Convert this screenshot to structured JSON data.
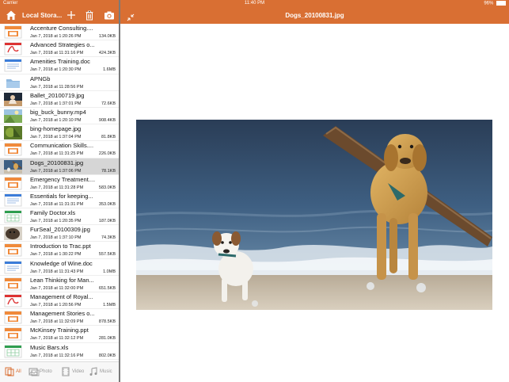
{
  "status_bar": {
    "carrier": "Carrier",
    "time": "11:40 PM",
    "battery": "96%",
    "battery_level": 0.96
  },
  "nav": {
    "home_icon": "home-icon",
    "title": "Local Stora...",
    "add_icon": "plus-icon",
    "trash_icon": "trash-icon",
    "camera_icon": "camera-icon",
    "collapse_icon": "collapse-arrows-icon",
    "viewer_title": "Dogs_20100831.jpg"
  },
  "colors": {
    "accent": "#D96F33",
    "selected_row": "#d6d6d6",
    "tab_inactive": "#999999"
  },
  "files": [
    {
      "name": "Accenture Consulting....",
      "date": "Jan 7, 2018 at 1:20:26 PM",
      "size": "134.0KB",
      "icon": "ppt"
    },
    {
      "name": "Advanced Strategies o...",
      "date": "Jan 7, 2018 at 11:31:16 PM",
      "size": "424.3KB",
      "icon": "pdf"
    },
    {
      "name": "Amenities Training.doc",
      "date": "Jan 7, 2018 at 1:20:30 PM",
      "size": "1.6MB",
      "icon": "doc"
    },
    {
      "name": "APNGb",
      "date": "Jan 7, 2018 at 11:28:56 PM",
      "size": "",
      "icon": "folder"
    },
    {
      "name": "Ballet_20100719.jpg",
      "date": "Jan 7, 2018 at 1:37:01 PM",
      "size": "72.6KB",
      "icon": "photo-ballet"
    },
    {
      "name": "big_buck_bunny.mp4",
      "date": "Jan 7, 2018 at 1:20:10 PM",
      "size": "908.4KB",
      "icon": "video"
    },
    {
      "name": "bing-homepage.jpg",
      "date": "Jan 7, 2018 at 1:37:04 PM",
      "size": "81.8KB",
      "icon": "photo-green"
    },
    {
      "name": "Communication Skills....",
      "date": "Jan 7, 2018 at 11:31:25 PM",
      "size": "226.0KB",
      "icon": "ppt"
    },
    {
      "name": "Dogs_20100831.jpg",
      "date": "Jan 7, 2018 at 1:37:06 PM",
      "size": "78.1KB",
      "icon": "photo-dogs",
      "selected": true
    },
    {
      "name": "Emergency Treatment....",
      "date": "Jan 7, 2018 at 11:31:28 PM",
      "size": "583.0KB",
      "icon": "ppt"
    },
    {
      "name": "Essentials for keeping...",
      "date": "Jan 7, 2018 at 11:31:31 PM",
      "size": "353.0KB",
      "icon": "doc"
    },
    {
      "name": "Family Doctor.xls",
      "date": "Jan 7, 2018 at 1:20:35 PM",
      "size": "187.0KB",
      "icon": "xls"
    },
    {
      "name": "FurSeal_20100309.jpg",
      "date": "Jan 7, 2018 at 1:37:10 PM",
      "size": "74.3KB",
      "icon": "photo-seal"
    },
    {
      "name": "Introduction to Trac.ppt",
      "date": "Jan 7, 2018 at 1:30:22 PM",
      "size": "557.5KB",
      "icon": "ppt"
    },
    {
      "name": "Knowledge of Wine.doc",
      "date": "Jan 7, 2018 at 11:31:43 PM",
      "size": "1.0MB",
      "icon": "doc"
    },
    {
      "name": "Lean Thinking for Man...",
      "date": "Jan 7, 2018 at 11:32:00 PM",
      "size": "651.5KB",
      "icon": "ppt"
    },
    {
      "name": "Management of Royal...",
      "date": "Jan 7, 2018 at 1:20:56 PM",
      "size": "1.5MB",
      "icon": "pdf"
    },
    {
      "name": "Management Stories o...",
      "date": "Jan 7, 2018 at 11:32:09 PM",
      "size": "878.5KB",
      "icon": "ppt"
    },
    {
      "name": "McKinsey Training.ppt",
      "date": "Jan 7, 2018 at 11:32:12 PM",
      "size": "281.0KB",
      "icon": "ppt"
    },
    {
      "name": "Music Bars.xls",
      "date": "Jan 7, 2018 at 11:32:16 PM",
      "size": "802.0KB",
      "icon": "xls"
    }
  ],
  "tabs": [
    {
      "label": "All",
      "icon": "all-files-icon",
      "active": true
    },
    {
      "label": "Photo",
      "icon": "photo-icon",
      "active": false
    },
    {
      "label": "Video",
      "icon": "video-icon",
      "active": false
    },
    {
      "label": "Music",
      "icon": "music-icon",
      "active": false
    }
  ],
  "viewer": {
    "image_icon": "dogs-photo"
  }
}
